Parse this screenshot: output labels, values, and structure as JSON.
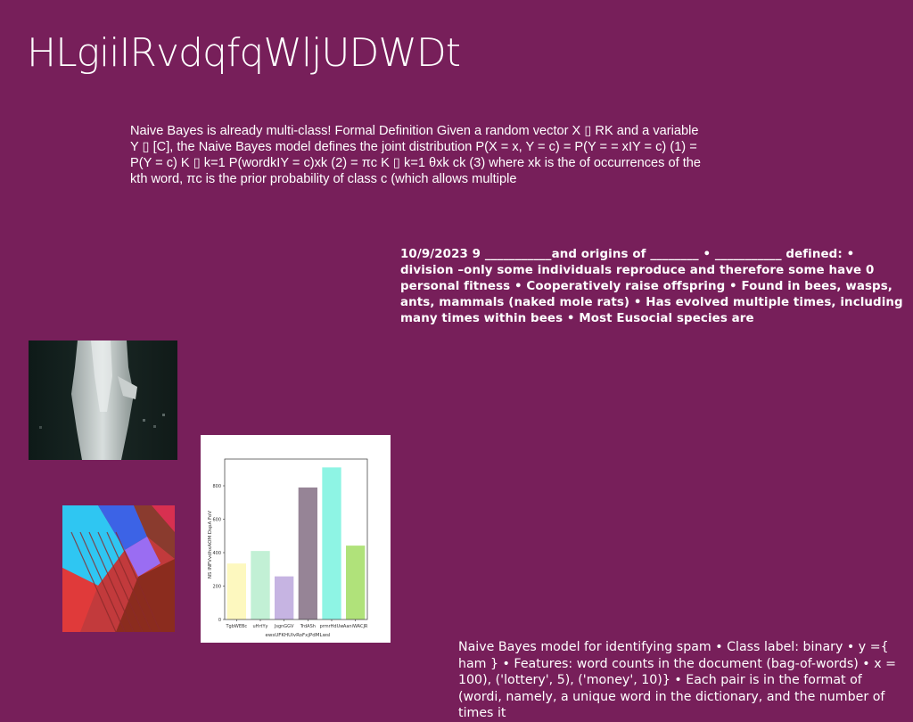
{
  "title": "HLgiiIRvdqfqWljUDWDt",
  "paragraph_1": "Naive Bayes is already multi-class! Formal Definition Given a random vector X ▯ RK and a variable Y ▯ [C], the Naive Bayes model defines the joint distribution P(X = x, Y = c) = P(Y = = xIY = c) (1) = P(Y = c) K ▯ k=1 P(wordkIY = c)xk (2) = πc K ▯ k=1 θxk ck (3) where xk is the of occurrences of the kth word, πc is the prior probability of class c (which allows multiple",
  "paragraph_2": "10/9/2023 9 ___________and origins of ________ • ___________ defined: • division –only some individuals reproduce and therefore some have 0 personal fitness • Cooperatively raise offspring • Found in bees, wasps, ants, mammals (naked mole rats) • Has evolved multiple times, including many times within bees • Most Eusocial species are",
  "paragraph_3": "Naive Bayes model for identifying spam • Class label: binary • y ={ ham } • Features: word counts in the document (bag-of-words) • x = 100), ('lottery', 5), ('money', 10)} • Each pair is in the format of (wordi, namely, a unique word in the dictionary, and the number of times it",
  "chart_data": {
    "type": "bar",
    "categories": [
      "TgbWEBc",
      "uHrtYy",
      "JsgnGGV",
      "TrdASh",
      "prmrHdUw",
      "AaniWACJR"
    ],
    "values": [
      335,
      410,
      258,
      790,
      910,
      442
    ],
    "colors": [
      "#fdf8bf",
      "#c2f0d5",
      "#c6b4e2",
      "#968496",
      "#8ef4e4",
      "#b0e27a"
    ],
    "xlabel": "ewsUFKHUIvRoFxjPdMLwsl",
    "ylabel": "NS INFVvdhxAOM DspA FoV",
    "yticks": [
      0,
      200,
      400,
      600,
      800
    ],
    "ylim": [
      0,
      960
    ]
  }
}
